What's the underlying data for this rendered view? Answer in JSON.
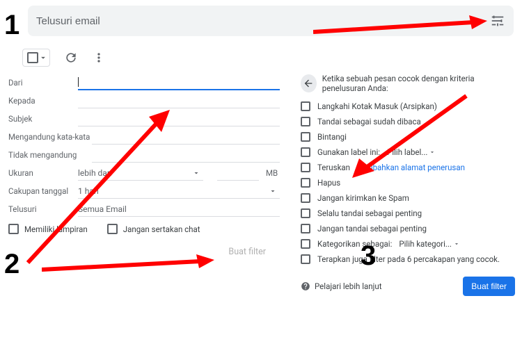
{
  "search": {
    "placeholder": "Telusuri email"
  },
  "form": {
    "from": "Dari",
    "to": "Kepada",
    "subject": "Subjek",
    "has_words": "Mengandung kata-kata",
    "doesnt_have": "Tidak mengandung",
    "size": "Ukuran",
    "size_mode": "lebih dari",
    "size_unit": "MB",
    "date_within": "Cakupan tanggal",
    "date_value": "1 hari",
    "search_in": "Telusuri",
    "search_in_value": "Semua Email",
    "has_attachment": "Memiliki lampiran",
    "exclude_chats": "Jangan sertakan chat",
    "create_filter": "Buat filter"
  },
  "actions": {
    "header": "Ketika sebuah pesan cocok dengan kriteria penelusuran Anda:",
    "items": [
      "Langkahi Kotak Masuk (Arsipkan)",
      "Tandai sebagai sudah dibaca",
      "Bintangi",
      "Gunakan label ini:",
      "Teruskan",
      "Hapus",
      "Jangan kirimkan ke Spam",
      "Selalu tandai sebagai penting",
      "Jangan tandai sebagai penting",
      "Kategorikan sebagai:",
      "Terapkan juga filter pada 6 percakapan yang cocok."
    ],
    "label_choose": "Pilih label...",
    "forward_link": "Tambahkan alamat penerusan",
    "category_choose": "Pilih kategori...",
    "learn_more": "Pelajari lebih lanjut",
    "create_filter_btn": "Buat filter"
  },
  "annotations": {
    "one": "1",
    "two": "2",
    "three": "3"
  }
}
